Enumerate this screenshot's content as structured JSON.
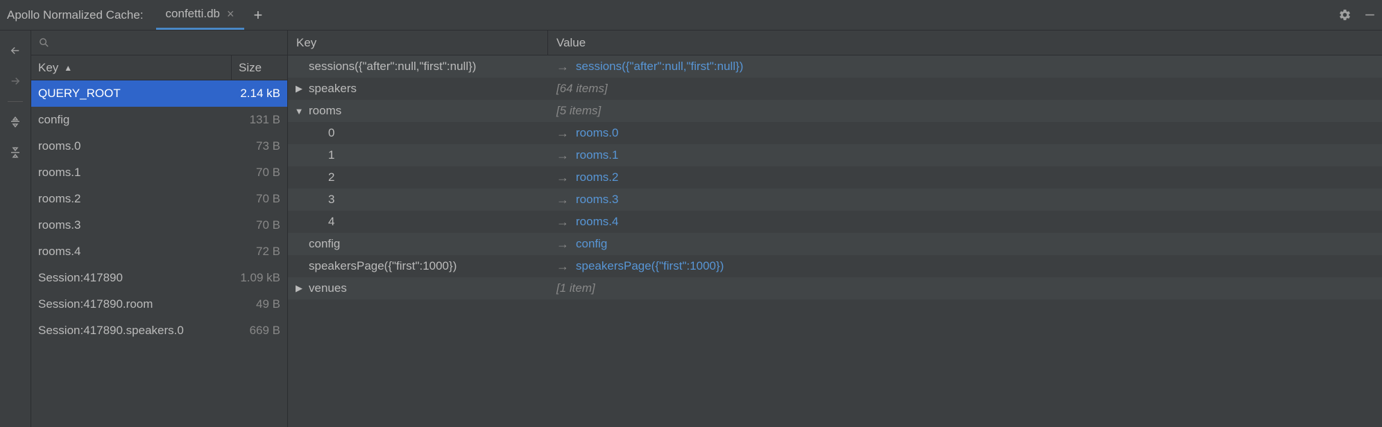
{
  "topbar": {
    "title": "Apollo Normalized Cache:",
    "tab_label": "confetti.db",
    "tab_close": "×",
    "add_label": "+"
  },
  "left": {
    "search_placeholder": "",
    "header_key": "Key",
    "header_size": "Size",
    "rows": [
      {
        "key": "QUERY_ROOT",
        "size": "2.14 kB",
        "selected": true
      },
      {
        "key": "config",
        "size": "131 B",
        "selected": false
      },
      {
        "key": "rooms.0",
        "size": "73 B",
        "selected": false
      },
      {
        "key": "rooms.1",
        "size": "70 B",
        "selected": false
      },
      {
        "key": "rooms.2",
        "size": "70 B",
        "selected": false
      },
      {
        "key": "rooms.3",
        "size": "70 B",
        "selected": false
      },
      {
        "key": "rooms.4",
        "size": "72 B",
        "selected": false
      },
      {
        "key": "Session:417890",
        "size": "1.09 kB",
        "selected": false
      },
      {
        "key": "Session:417890.room",
        "size": "49 B",
        "selected": false
      },
      {
        "key": "Session:417890.speakers.0",
        "size": "669 B",
        "selected": false
      }
    ]
  },
  "detail": {
    "header_key": "Key",
    "header_value": "Value",
    "rows": [
      {
        "indent": 0,
        "arrow": "",
        "key": "sessions({\"after\":null,\"first\":null})",
        "value_type": "ref",
        "value": "sessions({\"after\":null,\"first\":null})"
      },
      {
        "indent": 0,
        "arrow": "right",
        "key": "speakers",
        "value_type": "count",
        "value": "[64 items]"
      },
      {
        "indent": 0,
        "arrow": "down",
        "key": "rooms",
        "value_type": "count",
        "value": "[5 items]"
      },
      {
        "indent": 1,
        "arrow": "",
        "key": "0",
        "value_type": "ref",
        "value": "rooms.0"
      },
      {
        "indent": 1,
        "arrow": "",
        "key": "1",
        "value_type": "ref",
        "value": "rooms.1"
      },
      {
        "indent": 1,
        "arrow": "",
        "key": "2",
        "value_type": "ref",
        "value": "rooms.2"
      },
      {
        "indent": 1,
        "arrow": "",
        "key": "3",
        "value_type": "ref",
        "value": "rooms.3"
      },
      {
        "indent": 1,
        "arrow": "",
        "key": "4",
        "value_type": "ref",
        "value": "rooms.4"
      },
      {
        "indent": 0,
        "arrow": "",
        "key": "config",
        "value_type": "ref",
        "value": "config"
      },
      {
        "indent": 0,
        "arrow": "",
        "key": "speakersPage({\"first\":1000})",
        "value_type": "ref",
        "value": "speakersPage({\"first\":1000})"
      },
      {
        "indent": 0,
        "arrow": "right",
        "key": "venues",
        "value_type": "count",
        "value": "[1 item]"
      }
    ]
  }
}
